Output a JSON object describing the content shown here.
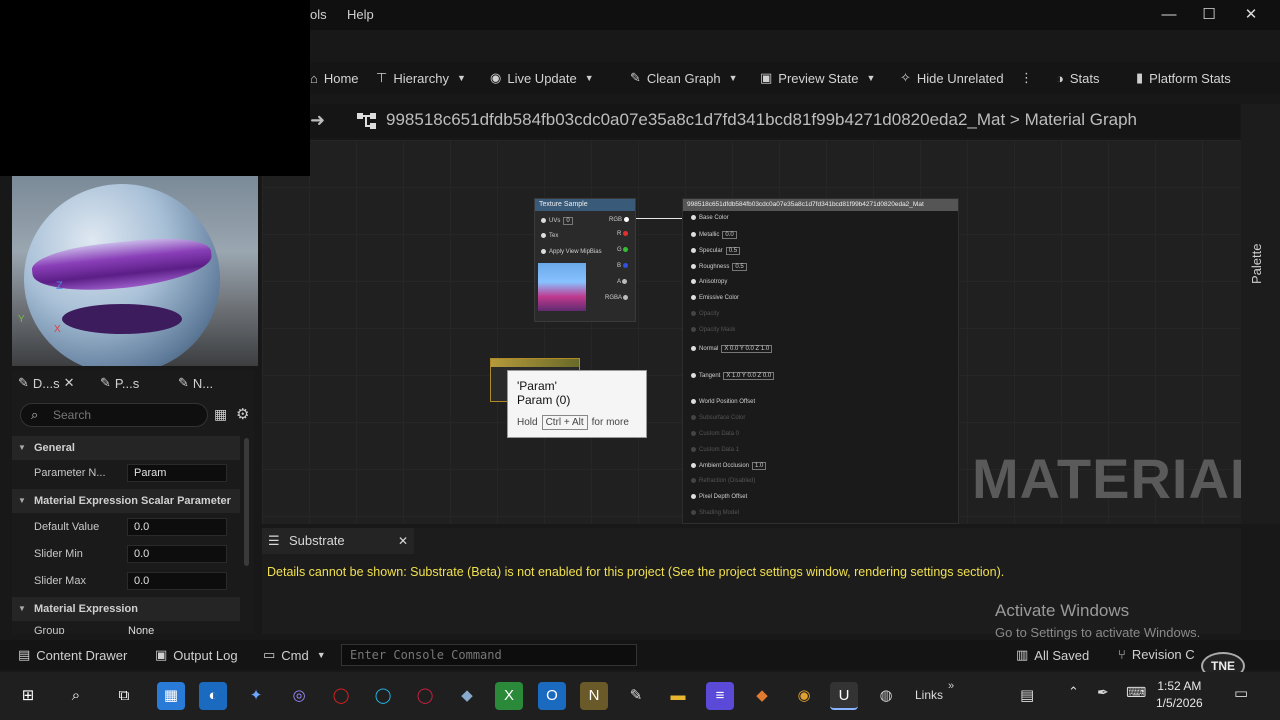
{
  "menu": {
    "tools_partial": "ols",
    "help": "Help"
  },
  "toolbar": {
    "home": "Home",
    "hierarchy": "Hierarchy",
    "live_update": "Live Update",
    "clean_graph": "Clean Graph",
    "preview_state": "Preview State",
    "hide_unrelated": "Hide Unrelated",
    "stats": "Stats",
    "platform_stats": "Platform Stats"
  },
  "breadcrumb": {
    "text": "998518c651dfdb584fb03cdc0a07e35a8c1d7fd341bcd81f99b4271d0820eda2_Mat  >  Material Graph"
  },
  "palette": {
    "label": "Palette"
  },
  "graph": {
    "texture_node": {
      "title": "Texture Sample",
      "pins_in": [
        "UVs",
        "Tex",
        "Apply View MipBias"
      ],
      "uv_value": "0",
      "pins_out": [
        "RGB",
        "R",
        "G",
        "B",
        "A",
        "RGBA"
      ]
    },
    "material_node": {
      "title": "998518c651dfdb584fb03cdc0a07e35a8c1d7fd341bcd81f99b4271d0820eda2_Mat",
      "pins": [
        {
          "label": "Base Color",
          "value": ""
        },
        {
          "label": "Metallic",
          "value": "0.0"
        },
        {
          "label": "Specular",
          "value": "0.5"
        },
        {
          "label": "Roughness",
          "value": "0.5"
        },
        {
          "label": "Anisotropy",
          "value": ""
        },
        {
          "label": "Emissive Color",
          "value": ""
        },
        {
          "label": "Opacity",
          "value": ""
        },
        {
          "label": "Opacity Mask",
          "value": ""
        },
        {
          "label": "Normal",
          "value": "X 0.0  Y 0.0  Z 1.0"
        },
        {
          "label": "Tangent",
          "value": "X 1.0  Y 0.0  Z 0.0"
        },
        {
          "label": "World Position Offset",
          "value": ""
        },
        {
          "label": "Subsurface Color",
          "value": ""
        },
        {
          "label": "Custom Data 0",
          "value": ""
        },
        {
          "label": "Custom Data 1",
          "value": ""
        },
        {
          "label": "Ambient Occlusion",
          "value": "1.0"
        },
        {
          "label": "Refraction (Disabled)",
          "value": ""
        },
        {
          "label": "Pixel Depth Offset",
          "value": ""
        },
        {
          "label": "Shading Model",
          "value": ""
        }
      ]
    },
    "tooltip": {
      "line1": "'Param'",
      "line2": "Param (0)",
      "hold": "Hold",
      "keys": "Ctrl + Alt",
      "more": "for more"
    },
    "watermark": "MATERIAL"
  },
  "details": {
    "tabs": [
      "D...s",
      "P...s",
      "N..."
    ],
    "search_placeholder": "Search",
    "sections": {
      "general": "General",
      "scalar": "Material Expression Scalar Parameter",
      "expression": "Material Expression"
    },
    "rows": [
      {
        "label": "Parameter N...",
        "value": "Param"
      },
      {
        "label": "Default Value",
        "value": "0.0"
      },
      {
        "label": "Slider Min",
        "value": "0.0"
      },
      {
        "label": "Slider Max",
        "value": "0.0"
      },
      {
        "label": "Group",
        "value": "None"
      }
    ]
  },
  "substrate": {
    "tab": "Substrate",
    "message": "Details cannot be shown: Substrate (Beta) is not enabled for this project (See the project settings window, rendering settings section).",
    "activate_title": "Activate Windows",
    "activate_sub": "Go to Settings to activate Windows."
  },
  "statusbar": {
    "content_drawer": "Content Drawer",
    "output_log": "Output Log",
    "cmd": "Cmd",
    "console_placeholder": "Enter Console Command",
    "all_saved": "All Saved",
    "revision": "Revision C",
    "badge": "TNE"
  },
  "taskbar": {
    "links": "Links",
    "time": "1:52 AM",
    "date": "1/5/2026"
  }
}
